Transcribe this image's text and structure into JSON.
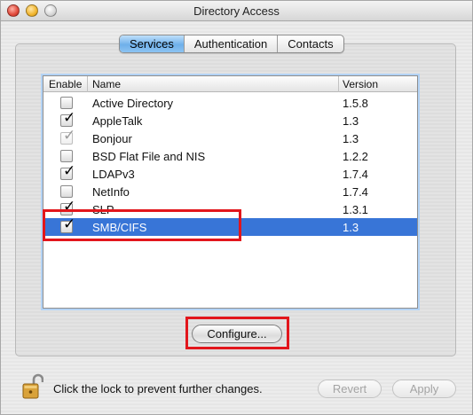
{
  "window": {
    "title": "Directory Access"
  },
  "tabs": [
    {
      "label": "Services",
      "selected": true
    },
    {
      "label": "Authentication",
      "selected": false
    },
    {
      "label": "Contacts",
      "selected": false
    }
  ],
  "table": {
    "columns": [
      "Enable",
      "Name",
      "Version"
    ],
    "rows": [
      {
        "enabled": false,
        "dimmed": false,
        "name": "Active Directory",
        "version": "1.5.8",
        "selected": false
      },
      {
        "enabled": true,
        "dimmed": false,
        "name": "AppleTalk",
        "version": "1.3",
        "selected": false
      },
      {
        "enabled": true,
        "dimmed": true,
        "name": "Bonjour",
        "version": "1.3",
        "selected": false
      },
      {
        "enabled": false,
        "dimmed": false,
        "name": "BSD Flat File and NIS",
        "version": "1.2.2",
        "selected": false
      },
      {
        "enabled": true,
        "dimmed": false,
        "name": "LDAPv3",
        "version": "1.7.4",
        "selected": false
      },
      {
        "enabled": false,
        "dimmed": false,
        "name": "NetInfo",
        "version": "1.7.4",
        "selected": false
      },
      {
        "enabled": true,
        "dimmed": false,
        "name": "SLP",
        "version": "1.3.1",
        "selected": false
      },
      {
        "enabled": true,
        "dimmed": false,
        "name": "SMB/CIFS",
        "version": "1.3",
        "selected": true
      }
    ],
    "selection_color": "#3875d7"
  },
  "buttons": {
    "configure": "Configure...",
    "revert": "Revert",
    "apply": "Apply"
  },
  "footer": {
    "lock_text": "Click the lock to prevent further changes.",
    "lock_icon": "unlocked-padlock-icon"
  },
  "highlight_color": "#e2161c"
}
